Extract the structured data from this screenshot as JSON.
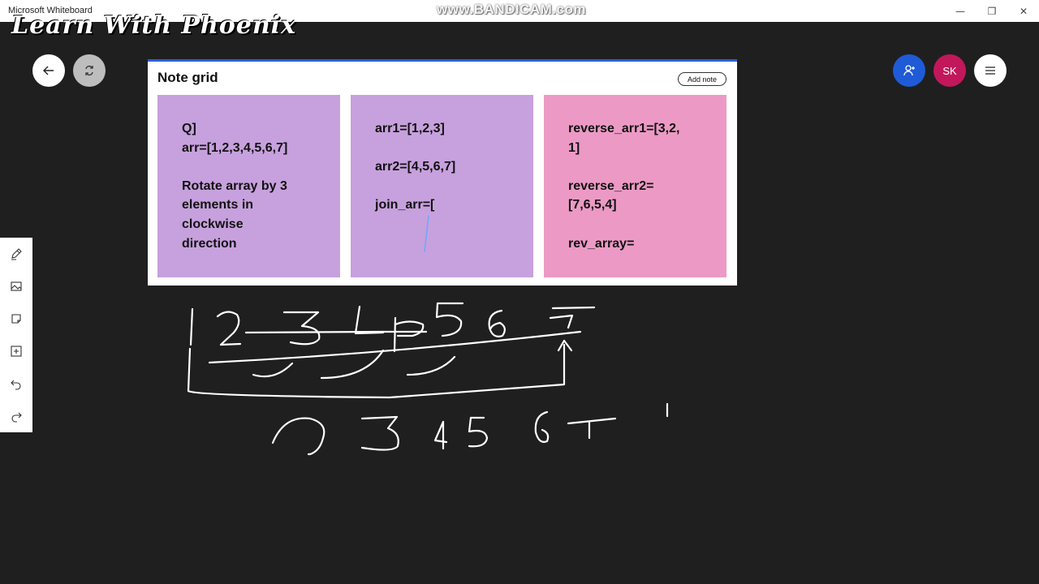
{
  "window": {
    "app_title": "Microsoft Whiteboard",
    "minimize_symbol": "—",
    "restore_symbol": "❐",
    "close_symbol": "✕"
  },
  "overlay": {
    "recorder_watermark": "www.BANDICAM.com",
    "channel_brand": "Learn With Phoenix"
  },
  "top_bar": {
    "back_icon": "arrow-left-icon",
    "share_icon": "share-link-icon",
    "invite_icon": "add-person-icon",
    "user_initials": "SK",
    "user_color": "#c2185b",
    "invite_color": "#1f5bd6",
    "menu_icon": "hamburger-menu-icon"
  },
  "note_grid": {
    "title": "Note grid",
    "add_note_label": "Add note",
    "accent_color": "#2b5fd9",
    "notes": [
      {
        "text": "Q]\narr=[1,2,3,4,5,6,7]\n\nRotate array by 3\nelements in\nclockwise\ndirection",
        "color": "#c7a1dd"
      },
      {
        "text": "arr1=[1,2,3]\n\narr2=[4,5,6,7]\n\njoin_arr=[",
        "color": "#c7a1dd"
      },
      {
        "text": "reverse_arr1=[3,2,\n1]\n\nreverse_arr2=\n[7,6,5,4]\n\nrev_array=",
        "color": "#ec9ac5"
      }
    ]
  },
  "side_toolbar": {
    "tools": [
      "pen-icon",
      "image-icon",
      "sticky-note-icon",
      "add-icon",
      "undo-icon",
      "redo-icon"
    ]
  },
  "canvas": {
    "background": "#1f1f1f",
    "ink_color": "#ffffff"
  }
}
